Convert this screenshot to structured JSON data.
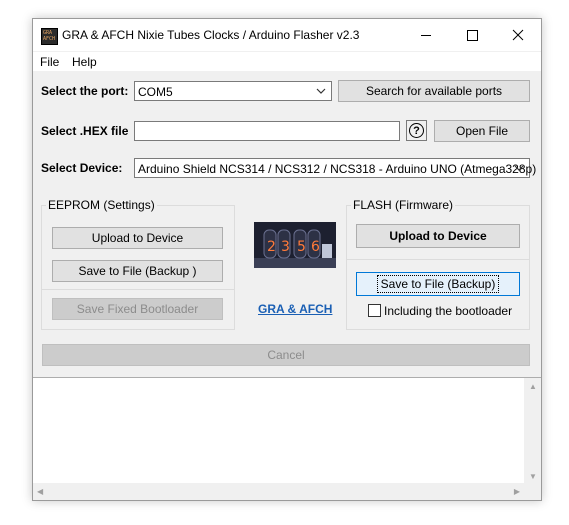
{
  "window": {
    "title": "GRA & AFCH Nixie Tubes Clocks / Arduino Flasher v2.3",
    "icon_text": "GRA AFCH"
  },
  "menu": {
    "file": "File",
    "help": "Help"
  },
  "port": {
    "label": "Select the port:",
    "value": "COM5",
    "search_button": "Search for available ports"
  },
  "hex": {
    "label": "Select .HEX file",
    "value": "",
    "help_symbol": "?",
    "open_button": "Open File"
  },
  "device": {
    "label": "Select Device:",
    "value": "Arduino Shield NCS314 / NCS312 / NCS318 - Arduino UNO (Atmega328p)"
  },
  "eeprom": {
    "group_label": "EEPROM (Settings)",
    "upload_button": "Upload to Device",
    "save_button": "Save to File (Backup )",
    "bootloader_button": "Save Fixed Bootloader"
  },
  "center": {
    "image_icon": "nixie-tubes-photo",
    "link": "GRA & AFCH"
  },
  "flash": {
    "group_label": "FLASH (Firmware)",
    "upload_button": "Upload to Device",
    "save_button": "Save to File (Backup)",
    "include_bootloader_label": "Including the bootloader",
    "include_bootloader_checked": false
  },
  "cancel_button": "Cancel",
  "log": {
    "text": ""
  },
  "colors": {
    "accent_focus": "#0078d7",
    "link": "#1a5fb4"
  }
}
